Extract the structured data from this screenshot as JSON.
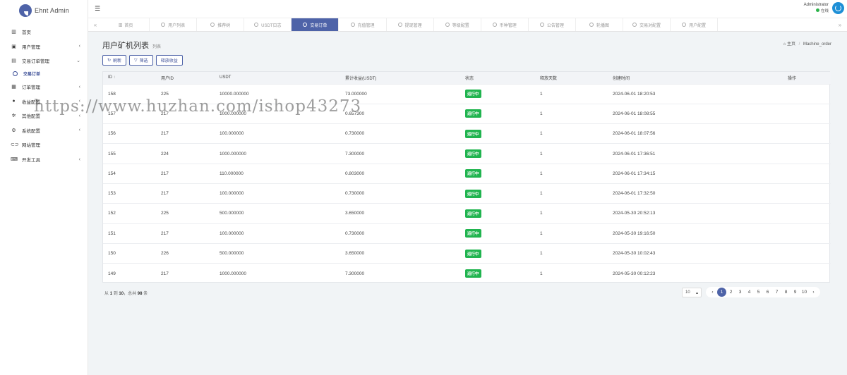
{
  "brand": {
    "name": "Ehnt Admin"
  },
  "sidebar": {
    "items": [
      {
        "icon": "bar-chart-icon",
        "glyph": "▥",
        "label": "首页",
        "chevron": ""
      },
      {
        "icon": "user-icon",
        "glyph": "▣",
        "label": "用户管理",
        "chevron": "‹"
      },
      {
        "icon": "list-icon",
        "glyph": "▤",
        "label": "交易订单管理",
        "chevron": "⌄"
      },
      {
        "icon": "cart-icon",
        "glyph": "▦",
        "label": "订单管理",
        "chevron": "‹"
      },
      {
        "icon": "circle-icon",
        "glyph": "●",
        "label": "收益配置",
        "chevron": "‹"
      },
      {
        "icon": "gear-icon",
        "glyph": "✲",
        "label": "其他配置",
        "chevron": "‹"
      },
      {
        "icon": "cog-icon",
        "glyph": "⚙",
        "label": "系统配置",
        "chevron": "‹"
      },
      {
        "icon": "toggle-icon",
        "glyph": "⊂⊃",
        "label": "网站管理",
        "chevron": ""
      },
      {
        "icon": "keyboard-icon",
        "glyph": "⌨",
        "label": "开发工具",
        "chevron": "‹"
      }
    ],
    "submenu_active": "交易订单"
  },
  "topbar": {
    "user_name": "Administrator",
    "user_status": "在线"
  },
  "tabs": [
    {
      "label": "首页",
      "active": false
    },
    {
      "label": "用户列表",
      "active": false
    },
    {
      "label": "推荐树",
      "active": false
    },
    {
      "label": "USDT日志",
      "active": false
    },
    {
      "label": "交易订单",
      "active": true
    },
    {
      "label": "充值管理",
      "active": false
    },
    {
      "label": "提现管理",
      "active": false
    },
    {
      "label": "等级配置",
      "active": false
    },
    {
      "label": "币种管理",
      "active": false
    },
    {
      "label": "公告管理",
      "active": false
    },
    {
      "label": "轮播图",
      "active": false
    },
    {
      "label": "交易对配置",
      "active": false
    },
    {
      "label": "用户配置",
      "active": false
    }
  ],
  "page": {
    "title": "用户矿机列表",
    "subtitle": "列表",
    "breadcrumb_home": "主页",
    "breadcrumb_current": "Machine_order"
  },
  "toolbar": {
    "refresh_label": "刷新",
    "filter_label": "筛选",
    "release_label": "释放收益"
  },
  "table": {
    "headers": [
      "ID",
      "用户ID",
      "USDT",
      "累计收益(USDT)",
      "状态",
      "释放天数",
      "创建时间",
      "操作"
    ],
    "rows": [
      {
        "id": "158",
        "uid": "225",
        "usdt": "10000.000000",
        "profit": "73.000000",
        "status": "运行中",
        "days": "1",
        "created": "2024-06-01 18:20:53"
      },
      {
        "id": "157",
        "uid": "217",
        "usdt": "1000.000000",
        "profit": "0.657300",
        "status": "运行中",
        "days": "1",
        "created": "2024-06-01 18:08:55"
      },
      {
        "id": "156",
        "uid": "217",
        "usdt": "100.000000",
        "profit": "0.730000",
        "status": "运行中",
        "days": "1",
        "created": "2024-06-01 18:07:56"
      },
      {
        "id": "155",
        "uid": "224",
        "usdt": "1000.000000",
        "profit": "7.300000",
        "status": "运行中",
        "days": "1",
        "created": "2024-06-01 17:36:51"
      },
      {
        "id": "154",
        "uid": "217",
        "usdt": "110.000000",
        "profit": "0.803000",
        "status": "运行中",
        "days": "1",
        "created": "2024-06-01 17:34:15"
      },
      {
        "id": "153",
        "uid": "217",
        "usdt": "100.000000",
        "profit": "0.730000",
        "status": "运行中",
        "days": "1",
        "created": "2024-06-01 17:32:50"
      },
      {
        "id": "152",
        "uid": "225",
        "usdt": "500.000000",
        "profit": "3.650000",
        "status": "运行中",
        "days": "1",
        "created": "2024-05-30 20:52:13"
      },
      {
        "id": "151",
        "uid": "217",
        "usdt": "100.000000",
        "profit": "0.730000",
        "status": "运行中",
        "days": "1",
        "created": "2024-05-30 19:16:50"
      },
      {
        "id": "150",
        "uid": "226",
        "usdt": "500.000000",
        "profit": "3.650000",
        "status": "运行中",
        "days": "1",
        "created": "2024-05-30 10:02:43"
      },
      {
        "id": "149",
        "uid": "217",
        "usdt": "1000.000000",
        "profit": "7.300000",
        "status": "运行中",
        "days": "1",
        "created": "2024-05-30 00:12:23"
      }
    ]
  },
  "pagination": {
    "info_prefix": "从",
    "info_from": "1",
    "info_mid": "到",
    "info_to": "10",
    "info_total_prefix": "，总共",
    "info_total": "98",
    "info_suffix": "条",
    "page_size": "10",
    "pages": [
      "1",
      "2",
      "3",
      "4",
      "5",
      "6",
      "7",
      "8",
      "9",
      "10"
    ],
    "current": "1"
  },
  "watermark": "https://www.huzhan.com/ishop43273",
  "colors": {
    "accent": "#4e63a8",
    "status_green": "#20b44f"
  }
}
